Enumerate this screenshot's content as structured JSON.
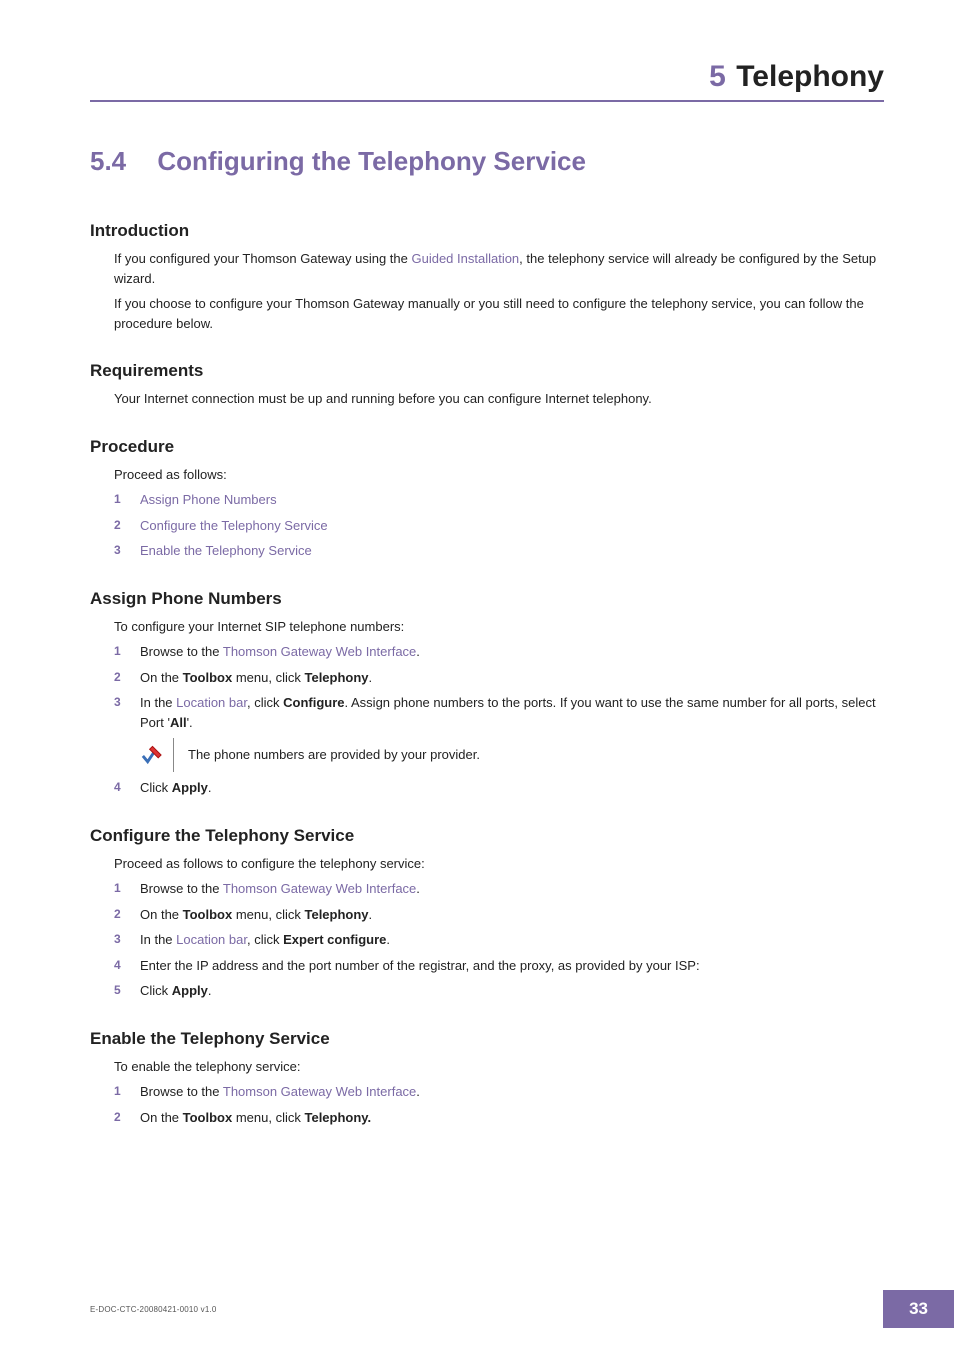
{
  "chapter": {
    "num": "5",
    "title": "Telephony"
  },
  "section": {
    "num": "5.4",
    "title": "Configuring the Telephony Service"
  },
  "intro": {
    "heading": "Introduction",
    "p1_a": "If you configured your Thomson Gateway using the ",
    "p1_link": "Guided Installation",
    "p1_b": ", the telephony service will already be configured by the Setup wizard.",
    "p2": "If you choose to configure your Thomson Gateway manually or you still need to configure the telephony service, you can follow the procedure below."
  },
  "req": {
    "heading": "Requirements",
    "p": "Your Internet connection must be up and running before you can configure Internet telephony."
  },
  "proc": {
    "heading": "Procedure",
    "lead": "Proceed as follows:",
    "items": [
      {
        "n": "1",
        "label": "Assign Phone Numbers"
      },
      {
        "n": "2",
        "label": "Configure the Telephony Service"
      },
      {
        "n": "3",
        "label": "Enable the Telephony Service"
      }
    ]
  },
  "assign": {
    "heading": "Assign Phone Numbers",
    "lead": "To configure your Internet SIP telephone numbers:",
    "s1_a": "Browse to the ",
    "s1_link": "Thomson Gateway Web Interface",
    "s1_b": ".",
    "s2_a": "On the ",
    "s2_b1": "Toolbox",
    "s2_c": " menu, click ",
    "s2_b2": "Telephony",
    "s2_d": ".",
    "s3_a": "In the ",
    "s3_link": "Location bar",
    "s3_b": ", click ",
    "s3_bold": "Configure",
    "s3_c": ". Assign phone numbers to the ports. If you want to use the same number for all ports, select Port '",
    "s3_bold2": "All",
    "s3_d": "'.",
    "note": "The phone numbers are provided by your provider.",
    "s4_a": "Click ",
    "s4_bold": "Apply",
    "s4_b": "."
  },
  "cfg": {
    "heading": "Configure the Telephony Service",
    "lead": "Proceed as follows to configure the telephony service:",
    "s1_a": "Browse to the ",
    "s1_link": "Thomson Gateway Web Interface",
    "s1_b": ".",
    "s2_a": "On the ",
    "s2_b1": "Toolbox",
    "s2_c": " menu, click ",
    "s2_b2": "Telephony",
    "s2_d": ".",
    "s3_a": "In the ",
    "s3_link": "Location bar",
    "s3_b": ", click ",
    "s3_bold": "Expert configure",
    "s3_c": ".",
    "s4": "Enter the IP address and the port number of the registrar, and the proxy, as provided by your ISP:",
    "s5_a": "Click ",
    "s5_bold": "Apply",
    "s5_b": "."
  },
  "enable": {
    "heading": "Enable the Telephony Service",
    "lead": "To enable the telephony service:",
    "s1_a": "Browse to the ",
    "s1_link": "Thomson Gateway Web Interface",
    "s1_b": ".",
    "s2_a": "On the ",
    "s2_b1": "Toolbox",
    "s2_c": " menu, click ",
    "s2_b2": "Telephony.",
    "s2_d": ""
  },
  "footer": {
    "doc": "E-DOC-CTC-20080421-0010 v1.0",
    "page": "33"
  }
}
